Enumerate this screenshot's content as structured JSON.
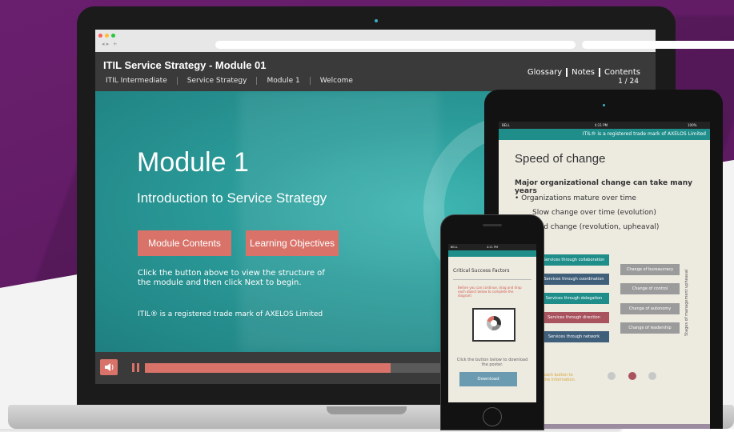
{
  "course": {
    "title": "ITIL Service Strategy - Module 01",
    "breadcrumb": [
      "ITIL Intermediate",
      "Service Strategy",
      "Module 1",
      "Welcome"
    ]
  },
  "topnav": {
    "glossary": "Glossary",
    "notes": "Notes",
    "contents": "Contents",
    "page_indicator": "1 / 24"
  },
  "slide": {
    "title": "Module 1",
    "subtitle": "Introduction to Service Strategy",
    "buttons": {
      "module_contents": "Module Contents",
      "learning_objectives": "Learning Objectives"
    },
    "instruction": "Click the button above to view the structure of the module and then click Next to begin.",
    "trademark": "ITIL® is a registered trade mark of AXELOS Limited"
  },
  "player": {
    "progress_fraction": 0.73,
    "accent_color": "#d9736a"
  },
  "tablet": {
    "status": {
      "carrier": "BELL",
      "time": "4:21 PM",
      "battery": "100%"
    },
    "trademark_band": "ITIL® is a registered trade mark of AXELOS Limited",
    "title": "Speed of change",
    "lead": "Major organizational change can take many years",
    "bullets": [
      "• Organizations mature over time",
      "Slow change over time (evolution)",
      "pid change (revolution, upheaval)"
    ],
    "left_boxes": [
      "Services through collaboration",
      "Services through coordination",
      "Services through delegation",
      "Services through direction",
      "Services through network"
    ],
    "right_boxes": [
      "Change of bureaucracy",
      "Change of control",
      "Change of autonomy",
      "Change of leadership"
    ],
    "vertical_label": "Stages of management upheaval",
    "hint": "each button to\nthe information."
  },
  "phone": {
    "status": {
      "carrier": "BELL",
      "time": "4:21 PM"
    },
    "title": "Critical Success Factors",
    "red_note": "Before you can continue, drag and drop each object below to complete the diagram.",
    "hint": "Click the button below to download the poster.",
    "download_label": "Download"
  }
}
